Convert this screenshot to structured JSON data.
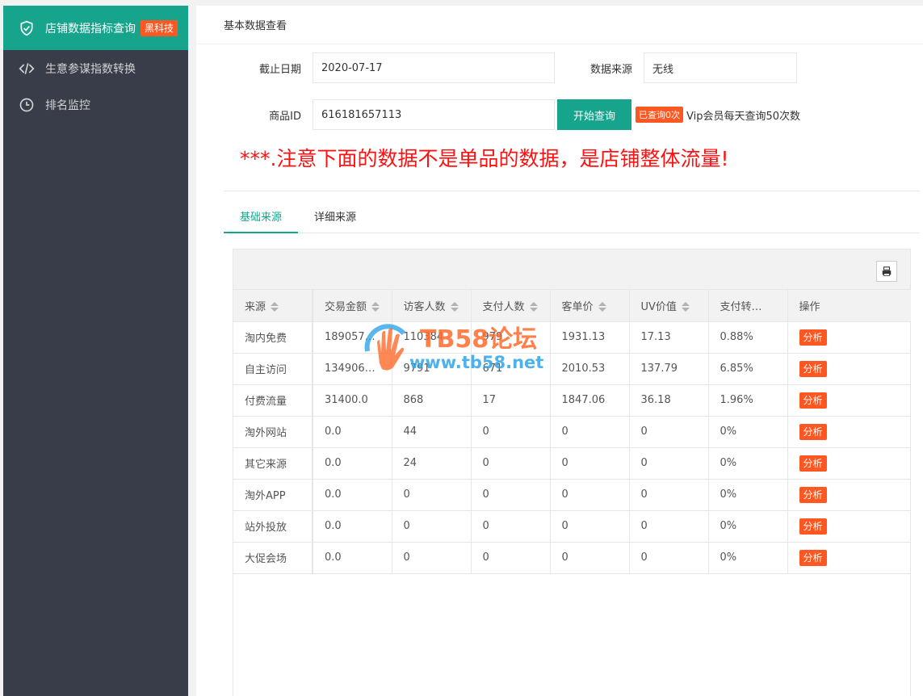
{
  "sidebar": {
    "items": [
      {
        "label": "店铺数据指标查询",
        "icon": "shield-check-icon",
        "badge": "黑科技",
        "active": true
      },
      {
        "label": "生意参谋指数转换",
        "icon": "code-icon",
        "active": false
      },
      {
        "label": "排名监控",
        "icon": "clock-icon",
        "active": false
      }
    ]
  },
  "main": {
    "header": "基本数据查看",
    "form": {
      "date_label": "截止日期",
      "date_value": "2020-07-17",
      "source_label": "数据来源",
      "source_value": "无线",
      "item_id_label": "商品ID",
      "item_id_value": "616181657113",
      "query_button": "开始查询",
      "query_count_tag": "已查询0次",
      "vip_note": "Vip会员每天查询50次数"
    },
    "warning": "***.注意下面的数据不是单品的数据，是店铺整体流量!",
    "tabs": [
      "基础来源",
      "详细来源"
    ],
    "table": {
      "columns": [
        "来源",
        "交易金额",
        "访客人数",
        "支付人数",
        "客单价",
        "UV价值",
        "支付转…",
        "操作"
      ],
      "action_label": "分析",
      "rows": [
        [
          "淘内免费",
          "189057…",
          "110384",
          "979",
          "1931.13",
          "17.13",
          "0.88%"
        ],
        [
          "自主访问",
          "134906…",
          "9791",
          "671",
          "2010.53",
          "137.79",
          "6.85%"
        ],
        [
          "付费流量",
          "31400.0",
          "868",
          "17",
          "1847.06",
          "36.18",
          "1.96%"
        ],
        [
          "淘外网站",
          "0.0",
          "44",
          "0",
          "0",
          "0",
          "0%"
        ],
        [
          "其它来源",
          "0.0",
          "24",
          "0",
          "0",
          "0",
          "0%"
        ],
        [
          "淘外APP",
          "0.0",
          "0",
          "0",
          "0",
          "0",
          "0%"
        ],
        [
          "站外投放",
          "0.0",
          "0",
          "0",
          "0",
          "0",
          "0%"
        ],
        [
          "大促会场",
          "0.0",
          "0",
          "0",
          "0",
          "0",
          "0%"
        ]
      ]
    }
  },
  "watermark": {
    "line1": "TB58论坛",
    "line2": "www.tb58.net"
  },
  "colors": {
    "accent": "#16a48c",
    "sidebar_bg": "#393d49",
    "danger": "#ff5722",
    "warning_text": "#ff1111"
  }
}
